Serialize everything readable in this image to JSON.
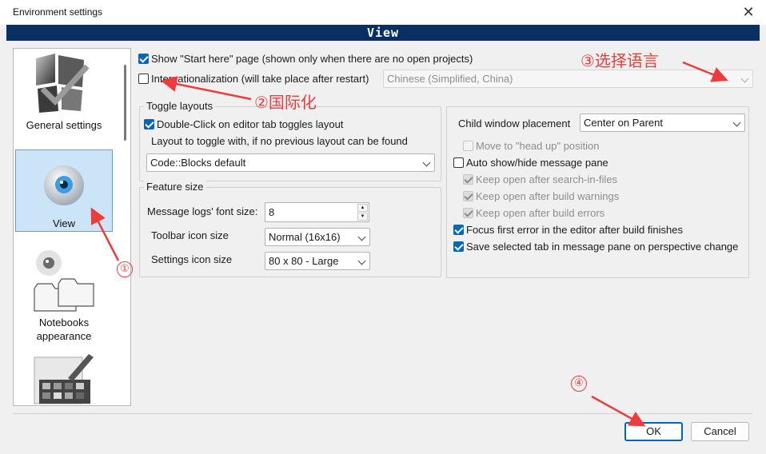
{
  "window": {
    "title": "Environment settings",
    "close_glyph": "✕"
  },
  "header": {
    "title": "View"
  },
  "sidebar": {
    "items": [
      {
        "label": "General settings",
        "icon": "general-settings-icon"
      },
      {
        "label": "View",
        "icon": "eye-icon",
        "selected": true
      },
      {
        "label": "Notebooks appearance",
        "icon": "notebooks-icon"
      },
      {
        "label": "",
        "icon": "colours-palette-icon"
      }
    ]
  },
  "top": {
    "start_here": {
      "label": "Show \"Start here\" page (shown only when there are no open projects)",
      "checked": true
    },
    "i18n": {
      "label": "Internationalization (will take place after restart)",
      "checked": false
    },
    "language": {
      "value": "Chinese (Simplified, China)",
      "enabled": false
    }
  },
  "toggle_layouts": {
    "title": "Toggle layouts",
    "double_click": {
      "label": "Double-Click on editor tab toggles layout",
      "checked": true
    },
    "fallback_label": "Layout to toggle with, if no previous layout can be found",
    "layout_value": "Code::Blocks default"
  },
  "feature_size": {
    "title": "Feature size",
    "log_font_label": "Message logs' font size:",
    "log_font_value": "8",
    "toolbar_label": "Toolbar icon size",
    "toolbar_value": "Normal (16x16)",
    "settings_label": "Settings icon size",
    "settings_value": "80 x 80 - Large"
  },
  "right": {
    "child_label": "Child window placement",
    "child_value": "Center on Parent",
    "head_up": {
      "label": "Move to \"head up\" position",
      "checked": false,
      "enabled": false
    },
    "auto_show": {
      "label": "Auto show/hide message pane",
      "checked": false
    },
    "keep_search": {
      "label": "Keep open after search-in-files",
      "checked": true,
      "enabled": false
    },
    "keep_warnings": {
      "label": "Keep open after build warnings",
      "checked": true,
      "enabled": false
    },
    "keep_errors": {
      "label": "Keep open after build errors",
      "checked": true,
      "enabled": false
    },
    "focus_error": {
      "label": "Focus first error in the editor after build finishes",
      "checked": true
    },
    "save_tab": {
      "label": "Save selected tab in message pane on perspective change",
      "checked": true
    }
  },
  "buttons": {
    "ok": "OK",
    "cancel": "Cancel"
  },
  "annotations": {
    "a1": "①",
    "a2": "②国际化",
    "a3": "③选择语言",
    "a4": "④",
    "color": "#ee3b3b"
  }
}
